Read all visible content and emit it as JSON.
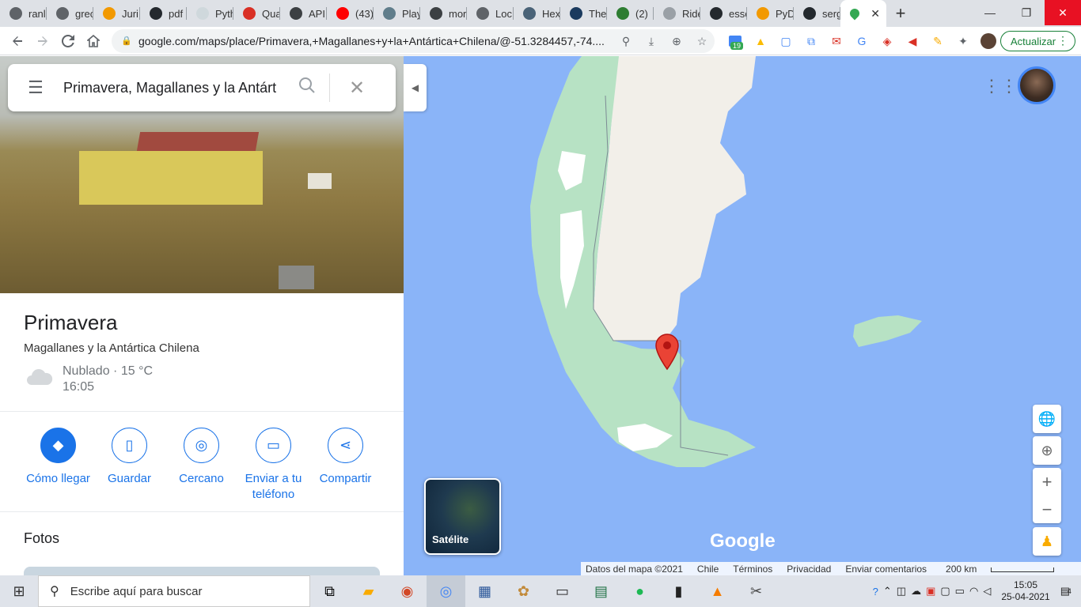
{
  "browser": {
    "tabs": [
      {
        "label": "ranl",
        "fav": "#5f6368"
      },
      {
        "label": "grec",
        "fav": "#5f6368"
      },
      {
        "label": "Juri",
        "fav": "#f29900"
      },
      {
        "label": "pdf",
        "fav": "#24292e"
      },
      {
        "label": "Pyth",
        "fav": "#cfd8dc"
      },
      {
        "label": "Qua",
        "fav": "#d93025"
      },
      {
        "label": "API",
        "fav": "#3c4043"
      },
      {
        "label": "(43)",
        "fav": "#ff0000"
      },
      {
        "label": "Play",
        "fav": "#607d8b"
      },
      {
        "label": "mor",
        "fav": "#3c4043"
      },
      {
        "label": "Loc",
        "fav": "#5f6368"
      },
      {
        "label": "Hex",
        "fav": "#4a6378"
      },
      {
        "label": "The",
        "fav": "#1a3a5e"
      },
      {
        "label": "(2)",
        "fav": "#2e7d32"
      },
      {
        "label": "Ride",
        "fav": "#9aa0a6"
      },
      {
        "label": "esse",
        "fav": "#24292e"
      },
      {
        "label": "PyD",
        "fav": "#f29900"
      },
      {
        "label": "serg",
        "fav": "#24292e"
      }
    ],
    "active_tab_close": "✕",
    "new_tab": "+",
    "window": {
      "minimize": "—",
      "restore": "❐",
      "close": "✕"
    },
    "url": "google.com/maps/place/Primavera,+Magallanes+y+la+Antártica+Chilena/@-51.3284457,-74....",
    "update_label": "Actualizar",
    "ext_badge": "19"
  },
  "search": {
    "value": "Primavera, Magallanes y la Antárt"
  },
  "place": {
    "title": "Primavera",
    "subtitle": "Magallanes y la Antártica Chilena",
    "weather": "Nublado · 15 °C",
    "time": "16:05"
  },
  "actions": [
    {
      "label": "Cómo llegar",
      "icon": "directions-icon"
    },
    {
      "label": "Guardar",
      "icon": "bookmark-icon"
    },
    {
      "label": "Cercano",
      "icon": "nearby-icon"
    },
    {
      "label": "Enviar a tu teléfono",
      "icon": "send-to-phone-icon"
    },
    {
      "label": "Compartir",
      "icon": "share-icon"
    }
  ],
  "section_photos": "Fotos",
  "map": {
    "satellite_label": "Satélite",
    "logo": "Google",
    "footer": {
      "data": "Datos del mapa ©2021",
      "country": "Chile",
      "terms": "Términos",
      "privacy": "Privacidad",
      "feedback": "Enviar comentarios",
      "scale": "200 km"
    }
  },
  "taskbar": {
    "search_placeholder": "Escribe aquí para buscar",
    "time": "15:05",
    "date": "25-04-2021",
    "notifications": "4"
  }
}
